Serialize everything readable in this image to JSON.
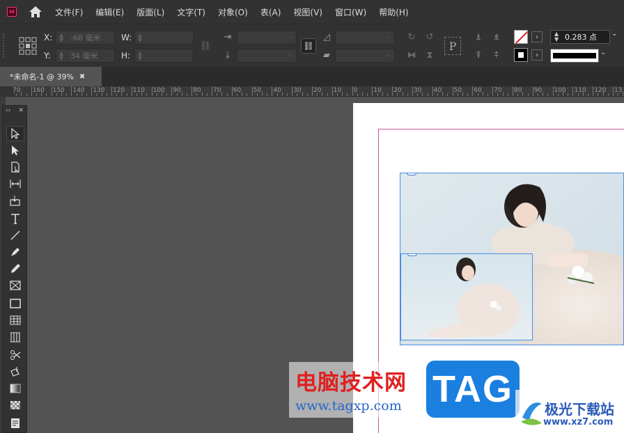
{
  "app": {
    "logo_text": "Id"
  },
  "menu": [
    "文件(F)",
    "编辑(E)",
    "版面(L)",
    "文字(T)",
    "对象(O)",
    "表(A)",
    "视图(V)",
    "窗口(W)",
    "帮助(H)"
  ],
  "control": {
    "x_label": "X:",
    "x_value": "-68 毫米",
    "y_label": "Y:",
    "y_value": "34 毫米",
    "w_label": "W:",
    "h_label": "H:",
    "stroke_weight": "0.283 点",
    "ref_point_icon": "reference-point-icon"
  },
  "tab": {
    "title": "*未命名-1 @ 39%",
    "close": "✖"
  },
  "ruler": {
    "labels": [
      "70",
      "160",
      "150",
      "140",
      "130",
      "120",
      "110",
      "100",
      "90",
      "80",
      "70",
      "60",
      "50",
      "40",
      "30",
      "20",
      "10",
      "0",
      "10",
      "20",
      "30",
      "40",
      "50",
      "60",
      "70",
      "80",
      "90",
      "100",
      "110",
      "120",
      "13"
    ]
  },
  "tools": [
    "selection-tool",
    "direct-selection-tool",
    "page-tool",
    "gap-tool",
    "content-collector-tool",
    "type-tool",
    "line-tool",
    "pen-tool",
    "pencil-tool",
    "rectangle-frame-tool",
    "rectangle-tool",
    "table-tool",
    "grid-tool",
    "scissors-tool",
    "free-transform-tool",
    "gradient-swatch-tool",
    "gradient-feather-tool",
    "note-tool"
  ],
  "watermark": {
    "title": "电脑技术网",
    "url": "www.tagxp.com",
    "badge": "TAG",
    "site_title": "极光下载站",
    "site_url": "www.xz7.com"
  },
  "colors": {
    "accent": "#4a8ee0",
    "margin_guide": "#c45aa0",
    "app_brand": "#ff3366"
  }
}
